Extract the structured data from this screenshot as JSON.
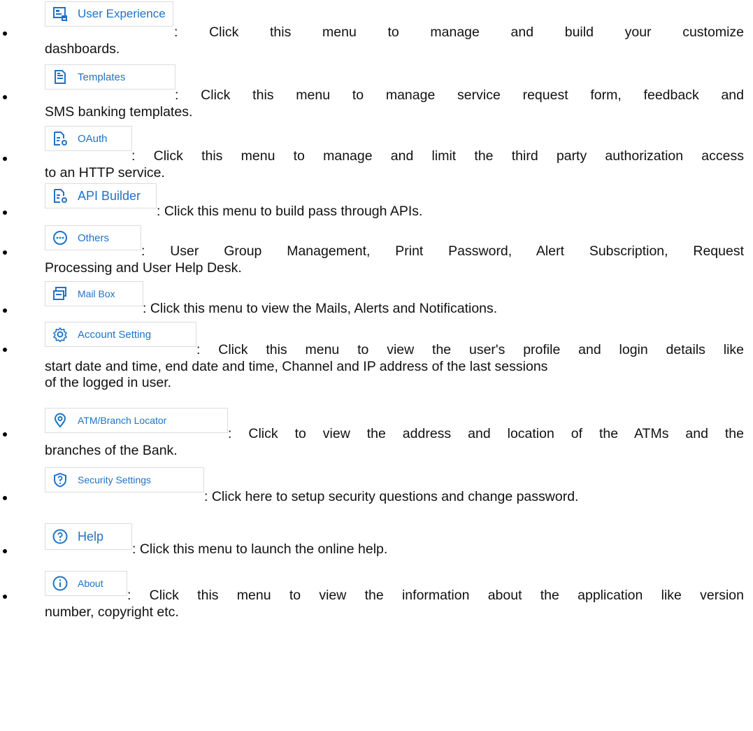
{
  "items": [
    {
      "label": "User Experience",
      "icon": "dashboard-icon",
      "line1": ":   Click this menu to manage and build your customize",
      "line2": "dashboards."
    },
    {
      "label": "Templates",
      "icon": "document-icon",
      "line1": ": Click this menu to manage service request form, feedback and",
      "line2": "SMS banking templates."
    },
    {
      "label": "OAuth",
      "icon": "document-gear-icon",
      "line1": ": Click this menu to manage and limit the third party authorization access",
      "line2": "to an HTTP service."
    },
    {
      "label": "API Builder",
      "icon": "document-gear-icon",
      "line1": ": Click this menu to build pass through APIs.",
      "line2": ""
    },
    {
      "label": "Others",
      "icon": "more-icon",
      "line1": ": User Group Management, Print Password, Alert Subscription, Request",
      "line2": "Processing and User Help Desk."
    },
    {
      "label": "Mail Box",
      "icon": "mailbox-icon",
      "line1": ": Click this menu to view the Mails, Alerts and Notifications.",
      "line2": ""
    },
    {
      "label": "Account Setting",
      "icon": "gear-icon",
      "line1": ": Click this menu to view the user's profile and   login details like",
      "line2": "start date and time, end date and time, Channel and IP address of the last sessions",
      "line3": "of the  logged in user."
    },
    {
      "label": "ATM/Branch Locator",
      "icon": "location-pin-icon",
      "line1": ": Click to view the address and location of the ATMs and the",
      "line2": "branches of the Bank."
    },
    {
      "label": "Security Settings",
      "icon": "shield-question-icon",
      "line1": ": Click here to setup security questions and change password.",
      "line2": ""
    },
    {
      "label": "Help",
      "icon": "help-icon",
      "line1": ": Click this menu to launch the online help.",
      "line2": ""
    },
    {
      "label": "About",
      "icon": "info-icon",
      "line1": ": Click this menu to view the information about the application like version",
      "line2": "number, copyright etc."
    }
  ]
}
